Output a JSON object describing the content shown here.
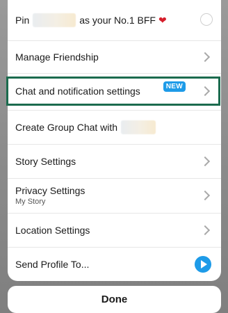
{
  "rows": {
    "pin": {
      "prefix": "Pin",
      "suffix": "as your No.1 BFF",
      "heart": "❤"
    },
    "manage_friendship": {
      "label": "Manage Friendship"
    },
    "chat_notification": {
      "label": "Chat and notification settings",
      "badge": "NEW"
    },
    "create_group": {
      "label": "Create Group Chat with"
    },
    "story_settings": {
      "label": "Story Settings"
    },
    "privacy_settings": {
      "label": "Privacy Settings",
      "sublabel": "My Story"
    },
    "location_settings": {
      "label": "Location Settings"
    },
    "send_profile": {
      "label": "Send Profile To..."
    }
  },
  "done_label": "Done",
  "colors": {
    "accent": "#1e9be8",
    "highlight": "#1b6b4e",
    "heart": "#d61e2b"
  }
}
